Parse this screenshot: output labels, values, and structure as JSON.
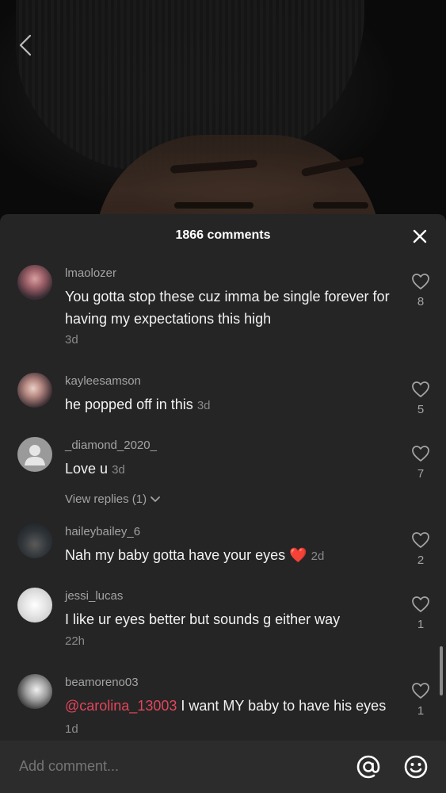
{
  "header": {
    "comment_count_label": "1866 comments"
  },
  "comments": [
    {
      "username": "lmaolozer",
      "text": "You gotta stop these cuz imma be single forever for having my expectations this high",
      "time": "3d",
      "likes": "8"
    },
    {
      "username": "kayleesamson",
      "text": "he popped off in this",
      "time": "3d",
      "likes": "5"
    },
    {
      "username": "_diamond_2020_",
      "text": "Love u",
      "time": "3d",
      "likes": "7",
      "replies_label": "View replies (1)"
    },
    {
      "username": "haileybailey_6",
      "text": "Nah my baby gotta have your eyes",
      "emoji": "❤️",
      "time": "2d",
      "likes": "2"
    },
    {
      "username": "jessi_lucas",
      "text": "I like ur eyes better but sounds g either way",
      "time": "22h",
      "likes": "1"
    },
    {
      "username": "beamoreno03",
      "mention": "@carolina_13003",
      "text": " I want MY baby to have his eyes",
      "time": "1d",
      "likes": "1"
    }
  ],
  "input": {
    "placeholder": "Add comment..."
  },
  "colors": {
    "sheet_bg": "#252525",
    "mention": "#e2455b",
    "input_bg": "#2c2c2c"
  },
  "icons": [
    "back-arrow-icon",
    "close-icon",
    "heart-outline-icon",
    "chevron-down-icon",
    "at-icon",
    "emoji-icon",
    "default-avatar-icon"
  ]
}
